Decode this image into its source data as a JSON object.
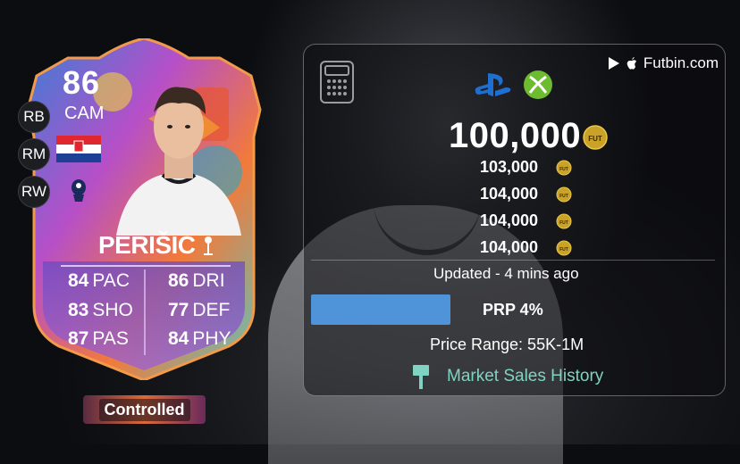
{
  "card": {
    "rating": "86",
    "position": "CAM",
    "alt_positions": [
      "RB",
      "RM",
      "RW"
    ],
    "name": "PERIŠIC",
    "stats": [
      {
        "value": "84",
        "label": "PAC"
      },
      {
        "value": "83",
        "label": "SHO"
      },
      {
        "value": "87",
        "label": "PAS"
      },
      {
        "value": "86",
        "label": "DRI"
      },
      {
        "value": "77",
        "label": "DEF"
      },
      {
        "value": "84",
        "label": "PHY"
      }
    ],
    "status_badge": "Controlled"
  },
  "panel": {
    "brand": "Futbin.com",
    "price_main": "100,000",
    "prices": [
      "103,000",
      "104,000",
      "104,000",
      "104,000"
    ],
    "coin_label": "FUT",
    "updated": "Updated - 4 mins ago",
    "prp_label": "PRP 4%",
    "prp_percent": 4,
    "price_range": "Price Range: 55K-1M",
    "market_link": "Market Sales History"
  },
  "colors": {
    "prp_bar": "#4f93d8",
    "link": "#7fd3c3",
    "coin": "#c9a227",
    "playstation": "#1f6fd1",
    "xbox": "#6dbb2f"
  },
  "icons": [
    "calculator-icon",
    "playstation-icon",
    "xbox-icon",
    "play-store-icon",
    "apple-icon",
    "coin-icon",
    "market-sales-icon",
    "club-badge-icon",
    "croatia-flag"
  ]
}
